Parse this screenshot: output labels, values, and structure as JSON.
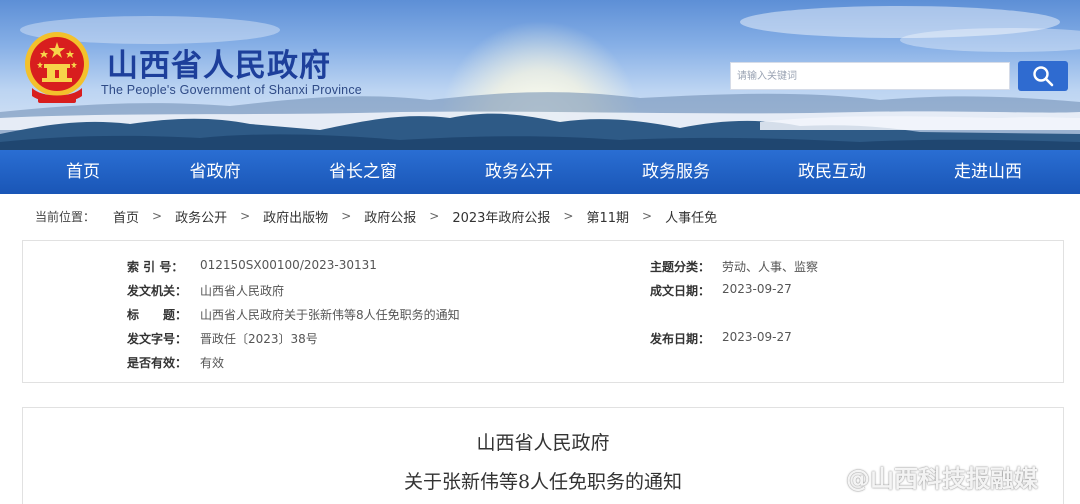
{
  "header": {
    "title": "山西省人民政府",
    "subtitle": "The People's Government of Shanxi Province",
    "emblem": "national-emblem-icon"
  },
  "search": {
    "placeholder": "请输入关键词",
    "button_icon": "search-icon"
  },
  "nav": {
    "items": [
      {
        "label": "首页"
      },
      {
        "label": "省政府"
      },
      {
        "label": "省长之窗"
      },
      {
        "label": "政务公开"
      },
      {
        "label": "政务服务"
      },
      {
        "label": "政民互动"
      },
      {
        "label": "走进山西"
      }
    ]
  },
  "breadcrumb": {
    "label": "当前位置：",
    "items": [
      "首页",
      "政务公开",
      "政府出版物",
      "政府公报",
      "2023年政府公报",
      "第11期",
      "人事任免"
    ],
    "separator": ">"
  },
  "meta": {
    "index_label": "索 引 号：",
    "index_value": "012150SX00100/2023-30131",
    "issuer_label": "发文机关：",
    "issuer_value": "山西省人民政府",
    "title_label": "标　　题：",
    "title_value": "山西省人民政府关于张新伟等8人任免职务的通知",
    "docno_label": "发文字号：",
    "docno_value": "晋政任〔2023〕38号",
    "valid_label": "是否有效：",
    "valid_value": "有效",
    "topic_label": "主题分类：",
    "topic_value": "劳动、人事、监察",
    "created_label": "成文日期：",
    "created_value": "2023-09-27",
    "published_label": "发布日期：",
    "published_value": "2023-09-27"
  },
  "document": {
    "issuer": "山西省人民政府",
    "title": "关于张新伟等8人任免职务的通知"
  },
  "watermark": {
    "text": "@山西科技报融媒",
    "icon": "weibo-icon"
  },
  "colors": {
    "nav_bg": "#1f5fc4",
    "title": "#1d3f9b",
    "search_button": "#2f6bd0"
  }
}
